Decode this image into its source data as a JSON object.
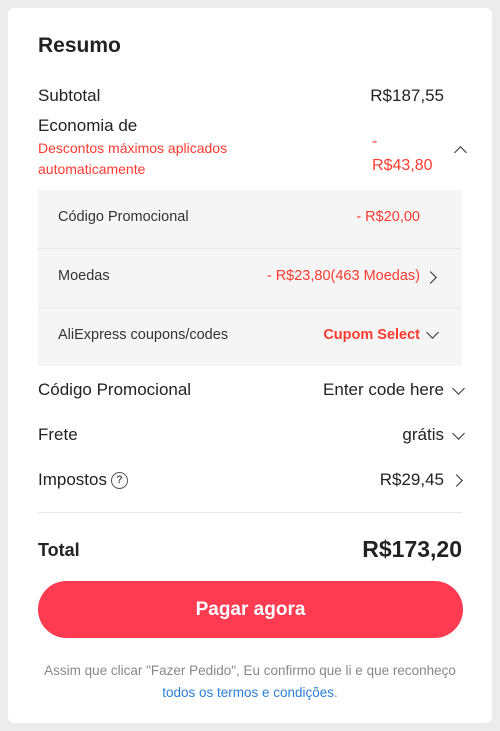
{
  "summary": {
    "title": "Resumo",
    "subtotal": {
      "label": "Subtotal",
      "value": "R$187,55"
    },
    "savings": {
      "label": "Economia de",
      "note": "Descontos máximos aplicados automaticamente",
      "value_sign": "-",
      "value": "R$43,80",
      "breakdown": [
        {
          "label": "Código Promocional",
          "value": "- R$20,00"
        },
        {
          "label": "Moedas",
          "value": "- R$23,80(463 Moedas)"
        },
        {
          "label": "AliExpress coupons/codes",
          "value": "Cupom Select"
        }
      ]
    },
    "promo_code": {
      "label": "Código Promocional",
      "value": "Enter code here"
    },
    "shipping": {
      "label": "Frete",
      "value": "grátis"
    },
    "taxes": {
      "label": "Impostos",
      "help": "?",
      "value": "R$29,45"
    },
    "total": {
      "label": "Total",
      "value": "R$173,20"
    },
    "pay_button": "Pagar agora",
    "disclaimer": {
      "text": "Assim que clicar \"Fazer Pedido\", Eu confirmo que li e que reconheço ",
      "link": "todos os termos e condições",
      "end": "."
    }
  },
  "colors": {
    "accent": "#ff3b52",
    "discount": "#ff3b30",
    "link": "#2b7fd6"
  }
}
